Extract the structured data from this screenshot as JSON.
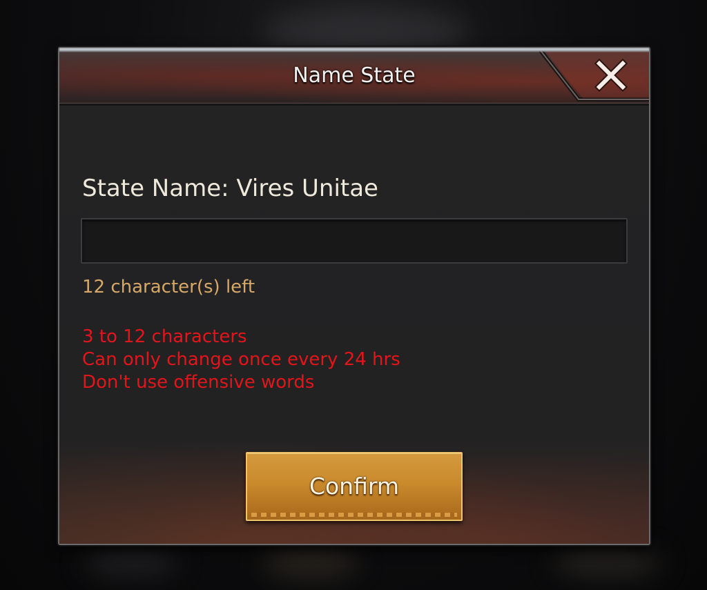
{
  "dialog": {
    "title": "Name State",
    "close_icon": "close-x-icon",
    "state_name_label": "State Name: Vires Unitae",
    "name_input": {
      "value": "",
      "placeholder": ""
    },
    "characters_left": "12 character(s) left",
    "rules": [
      "3 to 12 characters",
      "Can only change once every 24 hrs",
      "Don't use offensive words"
    ],
    "confirm_label": "Confirm"
  },
  "colors": {
    "title_text": "#f1f1f1",
    "characters_left_text": "#d7a868",
    "rules_text": "#e4151a",
    "confirm_button": "#c98a2c",
    "panel_background": "#232324"
  }
}
